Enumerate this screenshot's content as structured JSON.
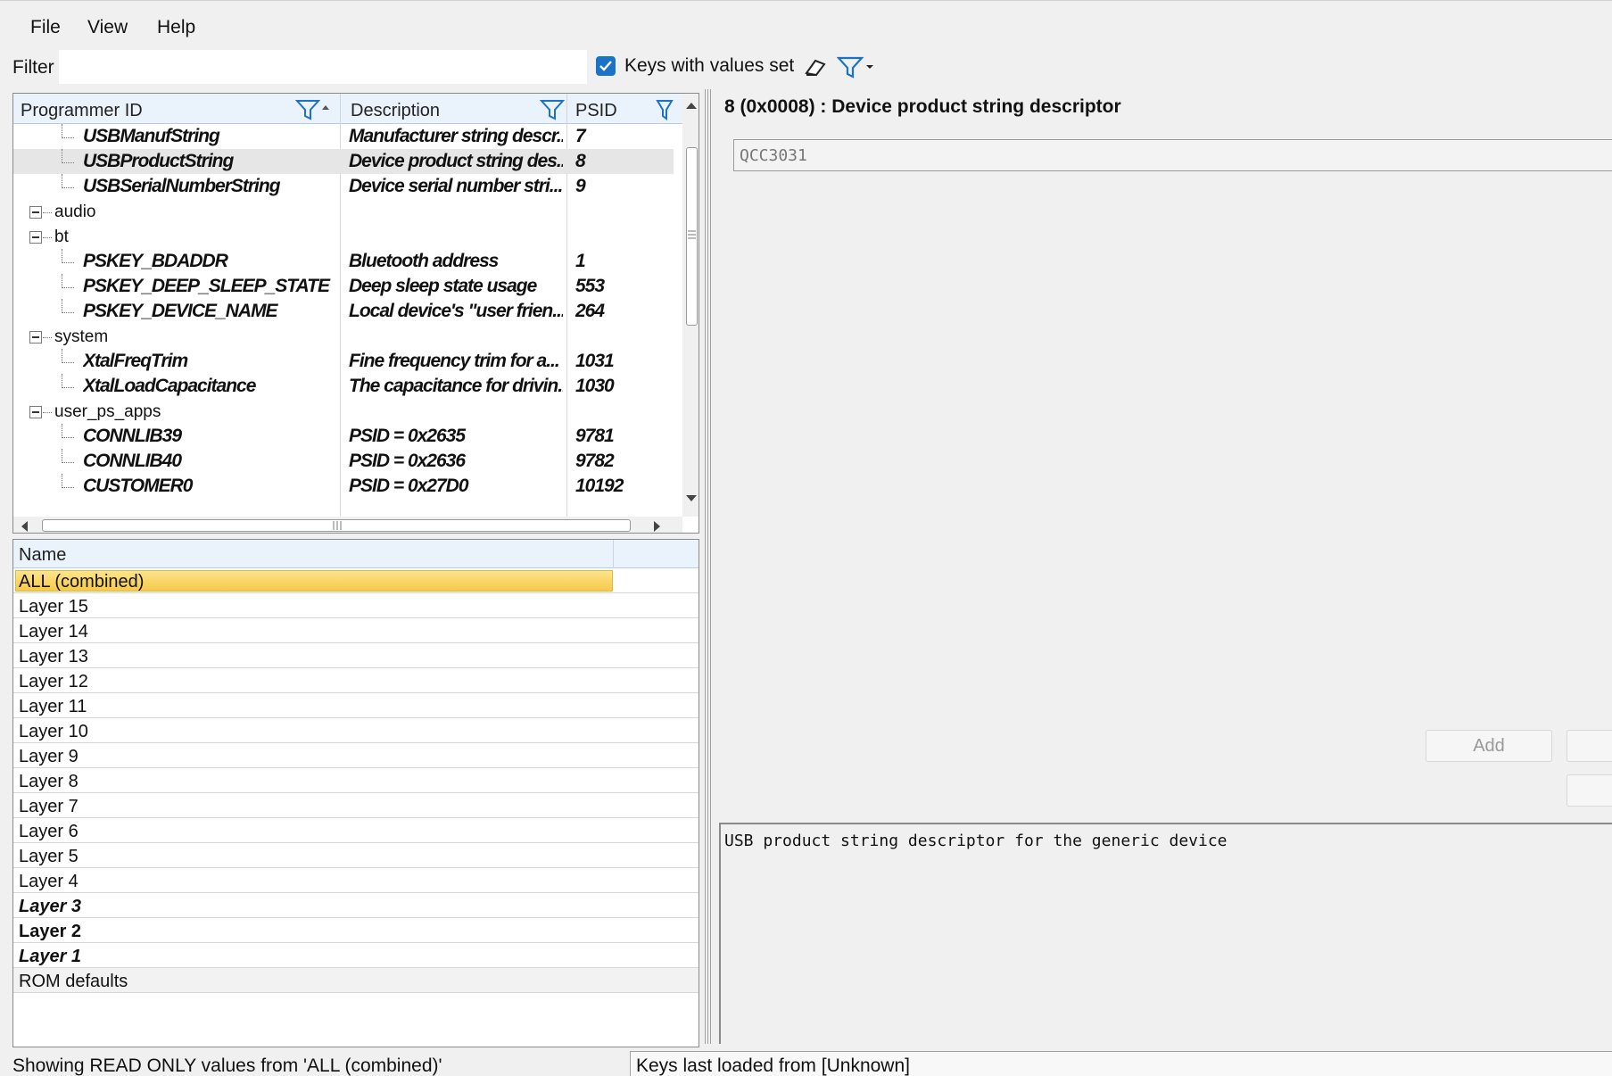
{
  "menu": {
    "file": "File",
    "view": "View",
    "help": "Help"
  },
  "filter": {
    "label": "Filter",
    "value": "",
    "keys_with_values_label": "Keys with values set",
    "keys_with_values_checked": true
  },
  "tree": {
    "columns": {
      "programmer_id": "Programmer ID",
      "description": "Description",
      "psid": "PSID"
    },
    "rows": [
      {
        "type": "key",
        "id": "USBManufString",
        "desc": "Manufacturer string descr...",
        "psid": "7"
      },
      {
        "type": "key",
        "id": "USBProductString",
        "desc": "Device product string des...",
        "psid": "8",
        "selected": true
      },
      {
        "type": "key",
        "id": "USBSerialNumberString",
        "desc": "Device serial number stri...",
        "psid": "9"
      },
      {
        "type": "group",
        "id": "audio"
      },
      {
        "type": "group",
        "id": "bt"
      },
      {
        "type": "key",
        "id": "PSKEY_BDADDR",
        "desc": "Bluetooth address",
        "psid": "1"
      },
      {
        "type": "key",
        "id": "PSKEY_DEEP_SLEEP_STATE",
        "desc": "Deep sleep state usage",
        "psid": "553"
      },
      {
        "type": "key",
        "id": "PSKEY_DEVICE_NAME",
        "desc": "Local device's \"user frien...",
        "psid": "264"
      },
      {
        "type": "group",
        "id": "system"
      },
      {
        "type": "key",
        "id": "XtalFreqTrim",
        "desc": "Fine frequency trim for a...",
        "psid": "1031"
      },
      {
        "type": "key",
        "id": "XtalLoadCapacitance",
        "desc": "The capacitance for drivin...",
        "psid": "1030"
      },
      {
        "type": "group",
        "id": "user_ps_apps"
      },
      {
        "type": "key",
        "id": "CONNLIB39",
        "desc": "PSID = 0x2635",
        "psid": "9781"
      },
      {
        "type": "key",
        "id": "CONNLIB40",
        "desc": "PSID = 0x2636",
        "psid": "9782"
      },
      {
        "type": "key",
        "id": "CUSTOMER0",
        "desc": "PSID = 0x27D0",
        "psid": "10192"
      }
    ]
  },
  "layers": {
    "header": "Name",
    "items": [
      {
        "label": "ALL (combined)",
        "style": "highlight"
      },
      {
        "label": "Layer 15",
        "style": "normal"
      },
      {
        "label": "Layer 14",
        "style": "normal"
      },
      {
        "label": "Layer 13",
        "style": "normal"
      },
      {
        "label": "Layer 12",
        "style": "normal"
      },
      {
        "label": "Layer 11",
        "style": "normal"
      },
      {
        "label": "Layer 10",
        "style": "normal"
      },
      {
        "label": "Layer 9",
        "style": "normal"
      },
      {
        "label": "Layer 8",
        "style": "normal"
      },
      {
        "label": "Layer 7",
        "style": "normal"
      },
      {
        "label": "Layer 6",
        "style": "normal"
      },
      {
        "label": "Layer 5",
        "style": "normal"
      },
      {
        "label": "Layer 4",
        "style": "normal"
      },
      {
        "label": "Layer 3",
        "style": "bolditalic"
      },
      {
        "label": "Layer 2",
        "style": "bold"
      },
      {
        "label": "Layer 1",
        "style": "bolditalic"
      },
      {
        "label": "ROM defaults",
        "style": "rom"
      }
    ]
  },
  "detail": {
    "title": "8 (0x0008) : Device product string descriptor",
    "value": "QCC3031",
    "add_button": "Add",
    "description": "USB product string descriptor for the generic device"
  },
  "status": {
    "left": "Showing READ ONLY values from 'ALL (combined)'",
    "right": "Keys last loaded from [Unknown]"
  },
  "colors": {
    "accent": "#1a73c7",
    "highlight": "#f6c94a",
    "header_bg": "#eaf2fb"
  }
}
